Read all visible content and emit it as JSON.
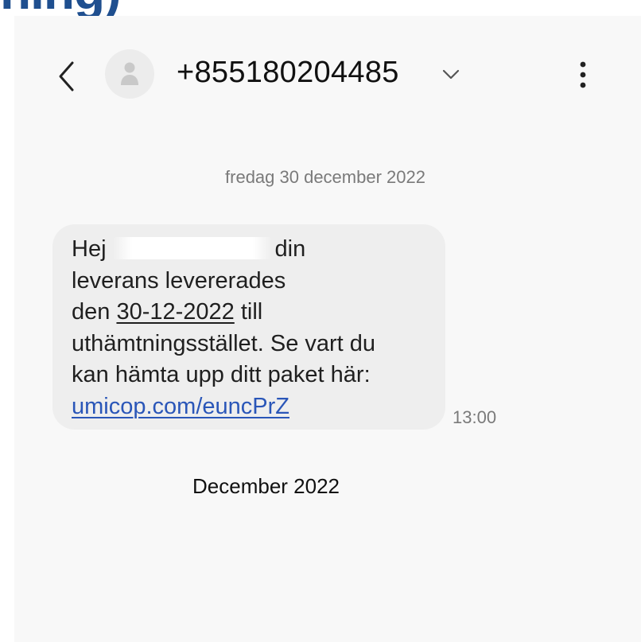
{
  "top_fragment": "ning)",
  "header": {
    "back_icon": "back-arrow-icon",
    "avatar_icon": "person-icon",
    "contact_number": "+855180204485",
    "expand_icon": "chevron-down-icon",
    "menu_icon": "more-vertical-icon"
  },
  "conversation": {
    "date_divider": "fredag 30 december 2022",
    "message": {
      "line1_start": "Hej",
      "line1_end": "din",
      "line2": "leverans levererades",
      "line3_prefix": "den ",
      "line3_date": "30-12-2022",
      "line3_suffix": " till",
      "line4": "uthämtningsstället. Se vart du",
      "line5": "kan hämta upp ditt paket här:",
      "link": "umicop.com/euncPrZ",
      "time": "13:00"
    }
  },
  "caption": "December 2022",
  "colors": {
    "accent_heading": "#1f4f8f",
    "link": "#2a56b8",
    "bubble": "#eeeeee",
    "background": "#f8f8f8"
  }
}
